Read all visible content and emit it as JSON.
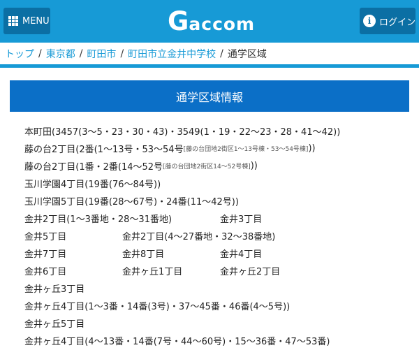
{
  "header": {
    "menu_label": "MENU",
    "logo_g": "G",
    "logo_rest": "accom",
    "login_label": "ログイン",
    "info_glyph": "i"
  },
  "breadcrumb": {
    "items": [
      "トップ",
      "東京都",
      "町田市",
      "町田市立金井中学校"
    ],
    "current": "通学区域",
    "separator": "/"
  },
  "section": {
    "title": "通学区域情報"
  },
  "areas": {
    "r1": "本町田(3457(3～5・23・30・43)・3549(1・19・22～23・28・41～42))",
    "r2_main": "藤の台2丁目(2番(1～13号・53～54号",
    "r2_note": "[藤の台団地2街区1～13号棟・53～54号棟]",
    "r2_end": "))",
    "r3_main": "藤の台2丁目(1番・2番(14～52号",
    "r3_note": "[藤の台団地2街区14～52号棟]",
    "r3_end": "))",
    "r4": "玉川学園4丁目(19番(76～84号))",
    "r5": "玉川学園5丁目(19番(28～67号)・24番(11～42号))",
    "r6_a": "金井2丁目(1～3番地・28～31番地)",
    "r6_b": "金井3丁目",
    "r7_a": "金井5丁目",
    "r7_b": "金井2丁目(4～27番地・32～38番地)",
    "r8_a": "金井7丁目",
    "r8_b": "金井8丁目",
    "r8_c": "金井4丁目",
    "r9_a": "金井6丁目",
    "r9_b": "金井ヶ丘1丁目",
    "r9_c": "金井ヶ丘2丁目",
    "r10": "金井ヶ丘3丁目",
    "r11": "金井ヶ丘4丁目(1～3番・14番(3号)・37～45番・46番(4～5号))",
    "r12": "金井ヶ丘5丁目",
    "r13": "金井ヶ丘4丁目(4～13番・14番(7号・44～60号)・15～36番・47～53番)"
  }
}
